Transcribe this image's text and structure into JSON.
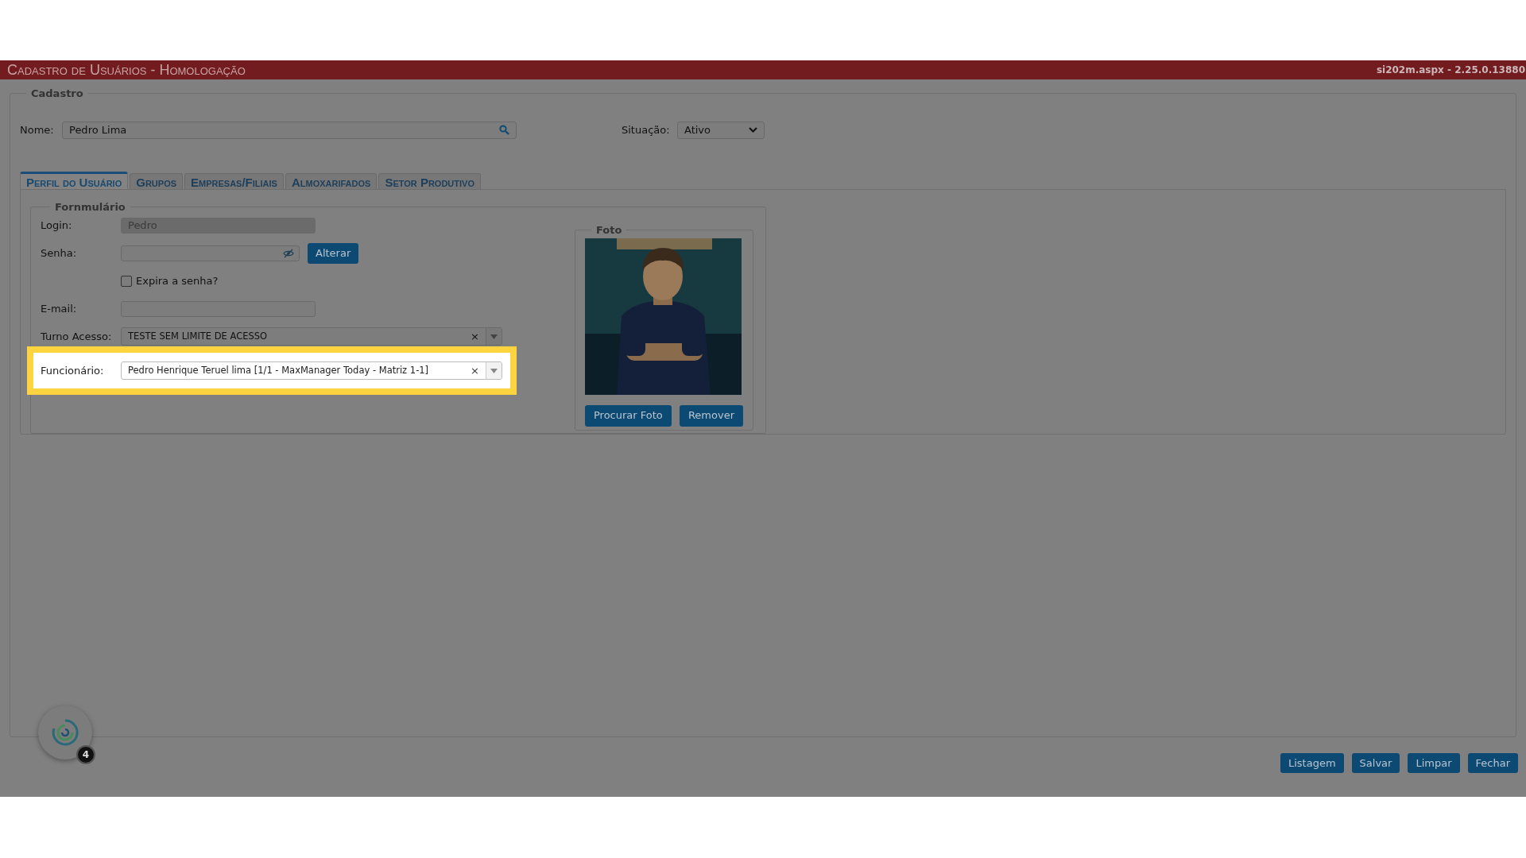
{
  "header": {
    "title": "Cadastro de Usuários",
    "subtitle": "- Homologação",
    "version": "si202m.aspx - 2.25.0.13880"
  },
  "cadastro": {
    "legend": "Cadastro",
    "nome": {
      "label": "Nome:",
      "value": "Pedro Lima"
    },
    "situacao": {
      "label": "Situação:",
      "value": "Ativo"
    }
  },
  "tabs": [
    {
      "label": "Perfil do Usuário",
      "selected": true
    },
    {
      "label": "Grupos",
      "selected": false
    },
    {
      "label": "Empresas/Filiais",
      "selected": false
    },
    {
      "label": "Almoxarifados",
      "selected": false
    },
    {
      "label": "Setor Produtivo",
      "selected": false
    }
  ],
  "formulario": {
    "legend": "Fornmulário",
    "fields": [
      {
        "kind": "text",
        "label": "Login:",
        "value": "Pedro",
        "disabled": true
      },
      {
        "kind": "password",
        "label": "Senha:",
        "button": "Alterar"
      },
      {
        "kind": "checkbox",
        "label": "Expira a senha?",
        "checked": false
      },
      {
        "kind": "text",
        "label": "E-mail:",
        "disabled": false
      },
      {
        "kind": "combo",
        "label": "Turno Acesso:",
        "value": "TESTE SEM LIMITE DE ACESSO",
        "clear": "×",
        "highlighted": false
      },
      {
        "kind": "combo",
        "label": "Funcionário:",
        "value": "Pedro Henrique Teruel lima [1/1 - MaxManager Today - Matriz 1-1]",
        "clear": "×",
        "highlighted": true
      }
    ]
  },
  "foto": {
    "legend": "Foto",
    "kind": "picture",
    "buttons": [
      "Procurar Foto",
      "Remover"
    ]
  },
  "chat_widget": {
    "badge": "4"
  },
  "actions": [
    "Listagem",
    "Salvar",
    "Limpar",
    "Fechar"
  ]
}
